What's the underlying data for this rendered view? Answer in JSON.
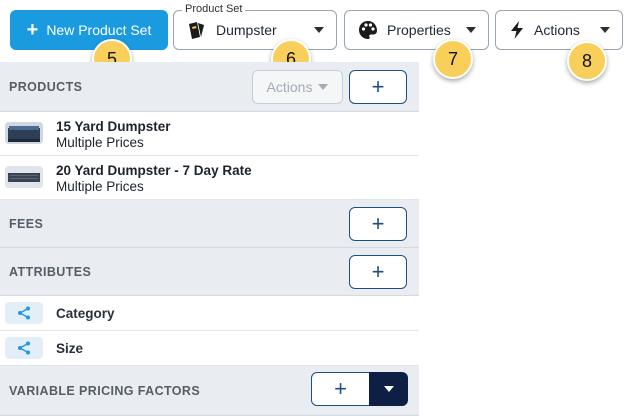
{
  "toolbar": {
    "new_product_set_label": "New Product Set",
    "product_set_field_label": "Product Set",
    "product_set_value": "Dumpster",
    "properties_label": "Properties",
    "actions_label": "Actions"
  },
  "badges": {
    "b5": "5",
    "b6": "6",
    "b7": "7",
    "b8": "8"
  },
  "products_section": {
    "title": "PRODUCTS",
    "actions_label": "Actions",
    "add_label": "+",
    "items": [
      {
        "name": "15 Yard Dumpster",
        "subtitle": "Multiple Prices"
      },
      {
        "name": "20 Yard Dumpster - 7 Day Rate",
        "subtitle": "Multiple Prices"
      }
    ]
  },
  "fees_section": {
    "title": "FEES",
    "add_label": "+"
  },
  "attributes_section": {
    "title": "ATTRIBUTES",
    "add_label": "+",
    "items": [
      {
        "label": "Category"
      },
      {
        "label": "Size"
      }
    ]
  },
  "variable_pricing_section": {
    "title": "VARIABLE PRICING FACTORS",
    "add_label": "+"
  },
  "colors": {
    "primary": "#1a9be0",
    "badge": "#f8cf5a",
    "section_bg": "#e9edf1",
    "navy": "#0e1f45",
    "outline_blue": "#1e4f82"
  }
}
